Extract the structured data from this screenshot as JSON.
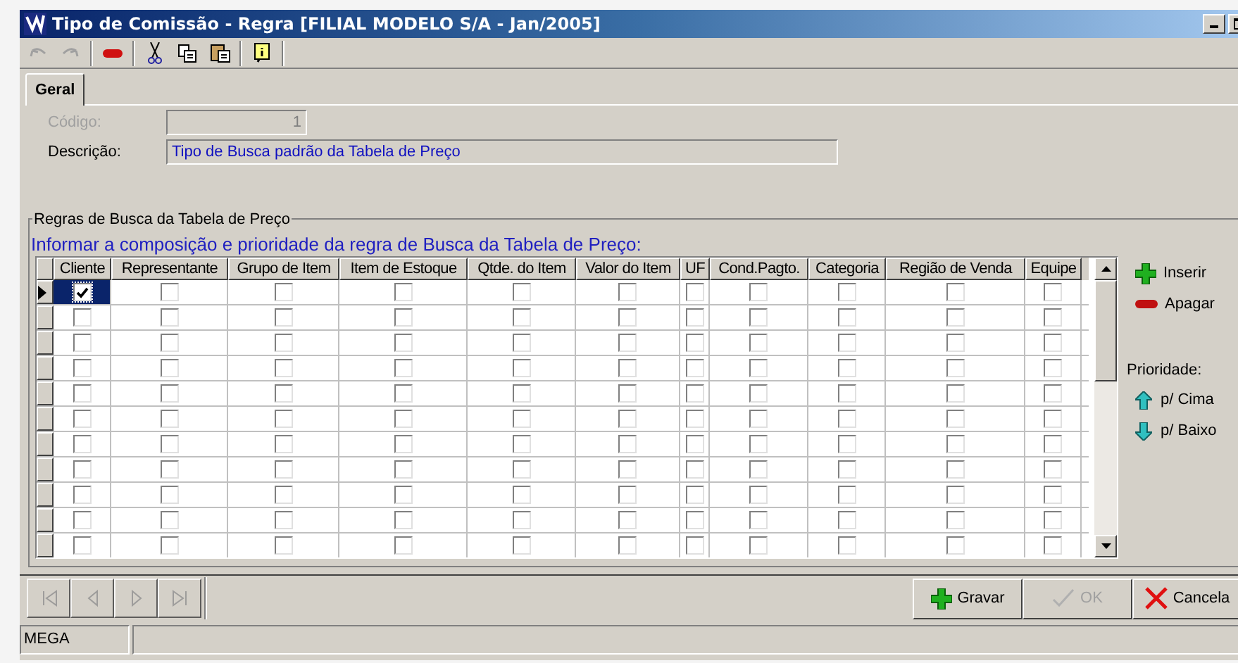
{
  "window": {
    "title": "Tipo de Comissão - Regra [FILIAL MODELO S/A - Jan/2005]"
  },
  "toolbar": [
    {
      "kind": "undo",
      "disabled": true
    },
    {
      "kind": "redo",
      "disabled": true
    },
    {
      "kind": "delete",
      "disabled": false
    },
    {
      "kind": "cut",
      "disabled": false
    },
    {
      "kind": "copy",
      "disabled": false
    },
    {
      "kind": "paste",
      "disabled": false
    },
    {
      "kind": "info",
      "disabled": false
    }
  ],
  "tabs": [
    {
      "label": "Geral",
      "selected": true
    }
  ],
  "fields": [
    {
      "label": "Código:",
      "value": "1",
      "disabled": true
    },
    {
      "label": "Descrição:",
      "value": "Tipo de Busca padrão da Tabela de Preço",
      "disabled": false
    }
  ],
  "group": {
    "title": "Regras de Busca da Tabela de Preço",
    "instruction": "Informar a composição e prioridade da regra de Busca da Tabela de Preço:"
  },
  "table": {
    "columns": [
      "Cliente",
      "Representante",
      "Grupo de Item",
      "Item de Estoque",
      "Qtde. do Item",
      "Valor do Item",
      "UF",
      "Cond.Pagto.",
      "Categoria",
      "Região de Venda",
      "Equipe"
    ],
    "rows": [
      {
        "selected": true,
        "cells": [
          {
            "checked": true
          },
          {
            "checked": false
          },
          {
            "checked": false
          },
          {
            "checked": false
          },
          {
            "checked": false
          },
          {
            "checked": false
          },
          {
            "checked": false
          },
          {
            "checked": false
          },
          {
            "checked": false
          },
          {
            "checked": false
          },
          {
            "checked": false
          }
        ]
      },
      {
        "selected": false,
        "cells": [
          {
            "checked": false
          },
          {
            "checked": false
          },
          {
            "checked": false
          },
          {
            "checked": false
          },
          {
            "checked": false
          },
          {
            "checked": false
          },
          {
            "checked": false
          },
          {
            "checked": false
          },
          {
            "checked": false
          },
          {
            "checked": false
          },
          {
            "checked": false
          }
        ]
      },
      {
        "selected": false,
        "cells": [
          {
            "checked": false
          },
          {
            "checked": false
          },
          {
            "checked": false
          },
          {
            "checked": false
          },
          {
            "checked": false
          },
          {
            "checked": false
          },
          {
            "checked": false
          },
          {
            "checked": false
          },
          {
            "checked": false
          },
          {
            "checked": false
          },
          {
            "checked": false
          }
        ]
      },
      {
        "selected": false,
        "cells": [
          {
            "checked": false
          },
          {
            "checked": false
          },
          {
            "checked": false
          },
          {
            "checked": false
          },
          {
            "checked": false
          },
          {
            "checked": false
          },
          {
            "checked": false
          },
          {
            "checked": false
          },
          {
            "checked": false
          },
          {
            "checked": false
          },
          {
            "checked": false
          }
        ]
      },
      {
        "selected": false,
        "cells": [
          {
            "checked": false
          },
          {
            "checked": false
          },
          {
            "checked": false
          },
          {
            "checked": false
          },
          {
            "checked": false
          },
          {
            "checked": false
          },
          {
            "checked": false
          },
          {
            "checked": false
          },
          {
            "checked": false
          },
          {
            "checked": false
          },
          {
            "checked": false
          }
        ]
      },
      {
        "selected": false,
        "cells": [
          {
            "checked": false
          },
          {
            "checked": false
          },
          {
            "checked": false
          },
          {
            "checked": false
          },
          {
            "checked": false
          },
          {
            "checked": false
          },
          {
            "checked": false
          },
          {
            "checked": false
          },
          {
            "checked": false
          },
          {
            "checked": false
          },
          {
            "checked": false
          }
        ]
      },
      {
        "selected": false,
        "cells": [
          {
            "checked": false
          },
          {
            "checked": false
          },
          {
            "checked": false
          },
          {
            "checked": false
          },
          {
            "checked": false
          },
          {
            "checked": false
          },
          {
            "checked": false
          },
          {
            "checked": false
          },
          {
            "checked": false
          },
          {
            "checked": false
          },
          {
            "checked": false
          }
        ]
      },
      {
        "selected": false,
        "cells": [
          {
            "checked": false
          },
          {
            "checked": false
          },
          {
            "checked": false
          },
          {
            "checked": false
          },
          {
            "checked": false
          },
          {
            "checked": false
          },
          {
            "checked": false
          },
          {
            "checked": false
          },
          {
            "checked": false
          },
          {
            "checked": false
          },
          {
            "checked": false
          }
        ]
      },
      {
        "selected": false,
        "cells": [
          {
            "checked": false
          },
          {
            "checked": false
          },
          {
            "checked": false
          },
          {
            "checked": false
          },
          {
            "checked": false
          },
          {
            "checked": false
          },
          {
            "checked": false
          },
          {
            "checked": false
          },
          {
            "checked": false
          },
          {
            "checked": false
          },
          {
            "checked": false
          }
        ]
      },
      {
        "selected": false,
        "cells": [
          {
            "checked": false
          },
          {
            "checked": false
          },
          {
            "checked": false
          },
          {
            "checked": false
          },
          {
            "checked": false
          },
          {
            "checked": false
          },
          {
            "checked": false
          },
          {
            "checked": false
          },
          {
            "checked": false
          },
          {
            "checked": false
          },
          {
            "checked": false
          }
        ]
      },
      {
        "selected": false,
        "cells": [
          {
            "checked": false
          },
          {
            "checked": false
          },
          {
            "checked": false
          },
          {
            "checked": false
          },
          {
            "checked": false
          },
          {
            "checked": false
          },
          {
            "checked": false
          },
          {
            "checked": false
          },
          {
            "checked": false
          },
          {
            "checked": false
          },
          {
            "checked": false
          }
        ]
      }
    ]
  },
  "side_actions": [
    {
      "kind": "insert",
      "label": "Inserir"
    },
    {
      "kind": "delete",
      "label": "Apagar"
    }
  ],
  "priority": {
    "label": "Prioridade:",
    "actions": [
      {
        "kind": "up",
        "label": "p/ Cima"
      },
      {
        "kind": "down",
        "label": "p/ Baixo"
      }
    ]
  },
  "navigator": [
    {
      "kind": "first",
      "disabled": true
    },
    {
      "kind": "prev",
      "disabled": true
    },
    {
      "kind": "next",
      "disabled": true
    },
    {
      "kind": "last",
      "disabled": true
    }
  ],
  "buttons": [
    {
      "kind": "save",
      "label": "Gravar",
      "disabled": false
    },
    {
      "kind": "ok",
      "label": "OK",
      "disabled": true
    },
    {
      "kind": "cancel",
      "label": "Cancela",
      "disabled": false
    }
  ],
  "status_bar": [
    "MEGA"
  ]
}
